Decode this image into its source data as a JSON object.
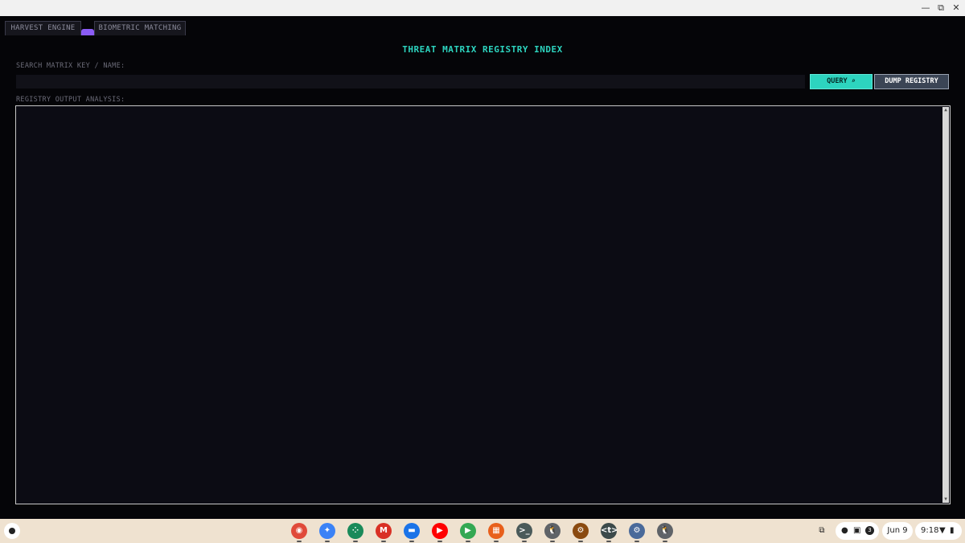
{
  "window": {
    "minimize_glyph": "—",
    "maximize_glyph": "⧉",
    "close_glyph": "✕"
  },
  "tabs": [
    {
      "label": "HARVEST ENGINE"
    },
    {
      "label": "BIOMETRIC MATCHING"
    }
  ],
  "main": {
    "title": "THREAT MATRIX REGISTRY INDEX",
    "search_label": "SEARCH MATRIX KEY / NAME:",
    "search_value": "",
    "query_label": "QUERY ⌕",
    "dump_label": "DUMP REGISTRY",
    "output_label": "REGISTRY OUTPUT ANALYSIS:",
    "output_text": ""
  },
  "colors": {
    "accent_teal": "#2dd4bf",
    "accent_purple": "#8b5cf6",
    "background": "#050508",
    "shelf": "#efe2d0"
  },
  "shelf": {
    "apps": [
      {
        "name": "chrome-icon",
        "glyph": "◉",
        "color": "#e04a3a"
      },
      {
        "name": "gemini-icon",
        "glyph": "✦",
        "color": "#3b82f6"
      },
      {
        "name": "app-grid-icon",
        "glyph": "⁘",
        "color": "#1a8a5a"
      },
      {
        "name": "gmail-icon",
        "glyph": "M",
        "color": "#d93025"
      },
      {
        "name": "files-icon",
        "glyph": "▬",
        "color": "#1a73e8"
      },
      {
        "name": "youtube-icon",
        "glyph": "▶",
        "color": "#ff0000"
      },
      {
        "name": "play-store-icon",
        "glyph": "▶",
        "color": "#34a853"
      },
      {
        "name": "checker-app-icon",
        "glyph": "▦",
        "color": "#e8601c"
      },
      {
        "name": "terminal-icon",
        "glyph": ">_",
        "color": "#4a5a5a"
      },
      {
        "name": "penguin-icon",
        "glyph": "🐧",
        "color": "#5f6368"
      },
      {
        "name": "settings-brown-icon",
        "glyph": "⚙",
        "color": "#8a4a10"
      },
      {
        "name": "code-editor-icon",
        "glyph": "<t>",
        "color": "#3c4a4a"
      },
      {
        "name": "settings-icon",
        "glyph": "⚙",
        "color": "#4a6a9a"
      },
      {
        "name": "penguin-2-icon",
        "glyph": "🐧",
        "color": "#5f6368"
      }
    ],
    "tray": {
      "date": "Jun 9",
      "time": "9:18",
      "notification_count": "3"
    }
  }
}
